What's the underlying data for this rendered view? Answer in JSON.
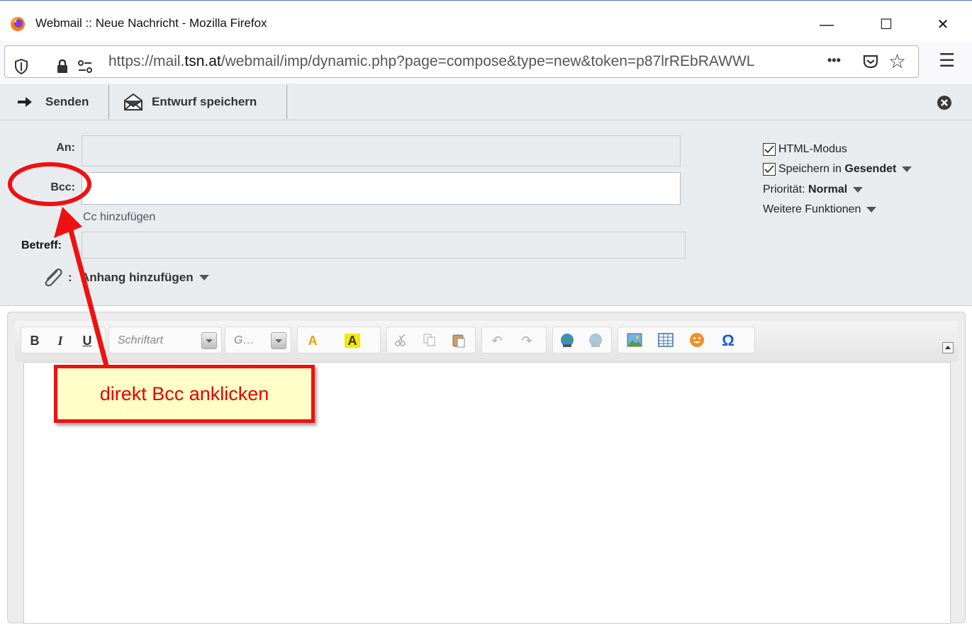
{
  "window": {
    "title": "Webmail :: Neue Nachricht - Mozilla Firefox",
    "minimize_glyph": "—",
    "maximize_glyph": "☐",
    "close_glyph": "✕"
  },
  "urlbar": {
    "url_prefix": "https://mail.",
    "url_domain": "tsn.at",
    "url_suffix": "/webmail/imp/dynamic.php?page=compose&type=new&token=p87lrREbRAWWL",
    "more_glyph": "•••",
    "bookmark_glyph": "☆",
    "menu_glyph": "☰"
  },
  "compose_toolbar": {
    "send_label": "Senden",
    "save_draft_label": "Entwurf speichern"
  },
  "headers": {
    "to_label": "An:",
    "bcc_label": "Bcc:",
    "add_cc_label": "Cc hinzufügen",
    "subject_label": "Betreff:",
    "attachment_colon": ":",
    "add_attachment_label": "Anhang hinzufügen"
  },
  "options": {
    "html_mode_label": "HTML-Modus",
    "html_mode_checked": true,
    "save_in_prefix": "Speichern in",
    "save_in_folder": "Gesendet",
    "save_in_checked": true,
    "priority_label": "Priorität:",
    "priority_value": "Normal",
    "more_functions_label": "Weitere Funktionen"
  },
  "editor": {
    "bold_label": "B",
    "italic_label": "I",
    "underline_label": "U",
    "font_placeholder": "Schriftart",
    "size_placeholder": "G…",
    "text_color_glyph": "A",
    "bg_color_glyph": "A",
    "special_char_glyph": "Ω"
  },
  "annotation": {
    "callout_text": "direkt Bcc anklicken",
    "color": "#ee1111"
  }
}
